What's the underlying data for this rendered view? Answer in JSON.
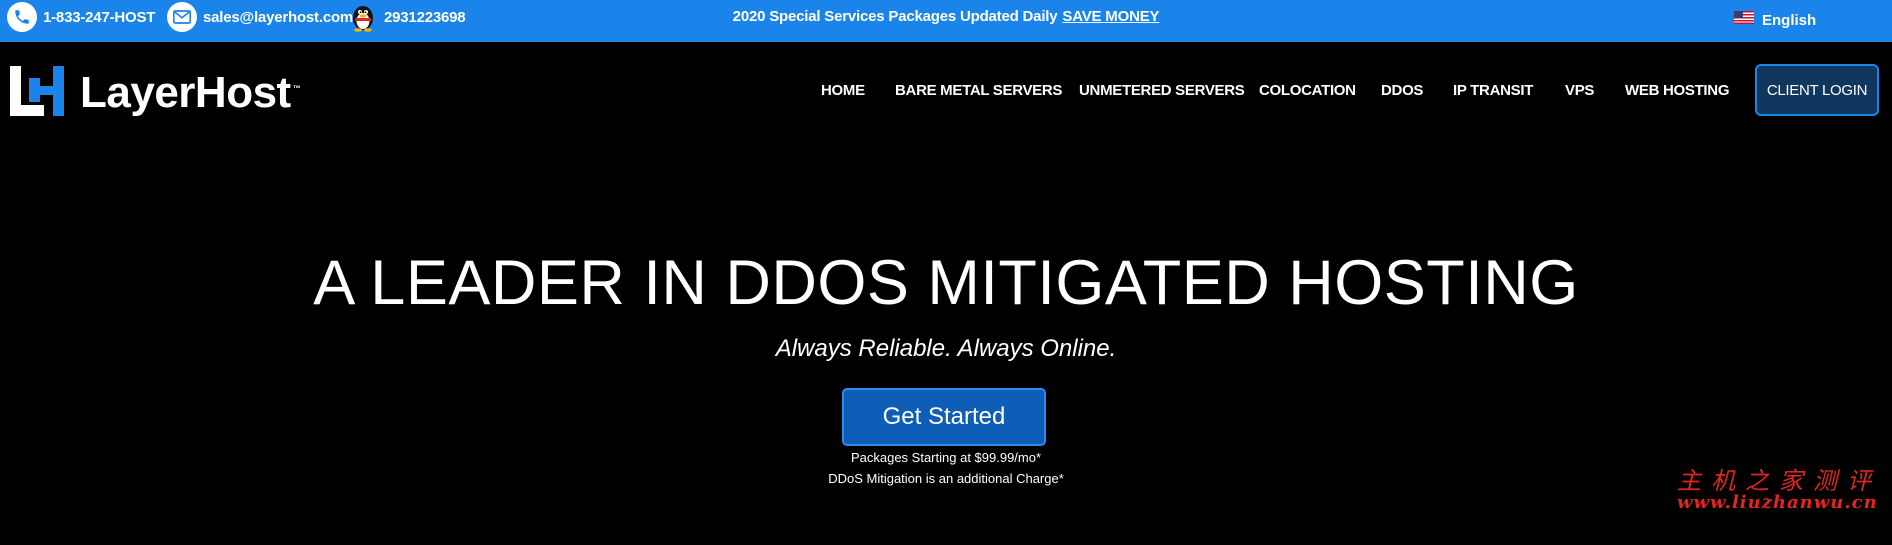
{
  "topbar": {
    "phone": "1-833-247-HOST",
    "email": "sales@layerhost.com",
    "qq": "2931223698",
    "promo_text": "2020 Special Services Packages Updated Daily",
    "promo_link": "SAVE MONEY",
    "language": "English",
    "bg_color": "#1a84ea"
  },
  "logo": {
    "text": "LayerHost",
    "tm": "™"
  },
  "nav": {
    "items": [
      "HOME",
      "BARE METAL SERVERS",
      "UNMETERED SERVERS",
      "COLOCATION",
      "DDOS",
      "IP TRANSIT",
      "VPS",
      "WEB HOSTING"
    ],
    "client_login": "CLIENT LOGIN"
  },
  "hero": {
    "title": "A LEADER IN DDOS MITIGATED HOSTING",
    "subtitle": "Always Reliable. Always Online.",
    "cta": "Get Started",
    "note1": "Packages Starting at $99.99/mo*",
    "note2": "DDoS Mitigation is an additional Charge*"
  },
  "watermark": {
    "chinese": "主机之家测评",
    "url": "www.liuzhanwu.cn"
  },
  "icons": {
    "phone": "phone-icon",
    "email": "email-icon",
    "qq": "qq-penguin-icon",
    "flag": "us-flag-icon",
    "logo_mark": "layerhost-logo-mark-icon"
  }
}
